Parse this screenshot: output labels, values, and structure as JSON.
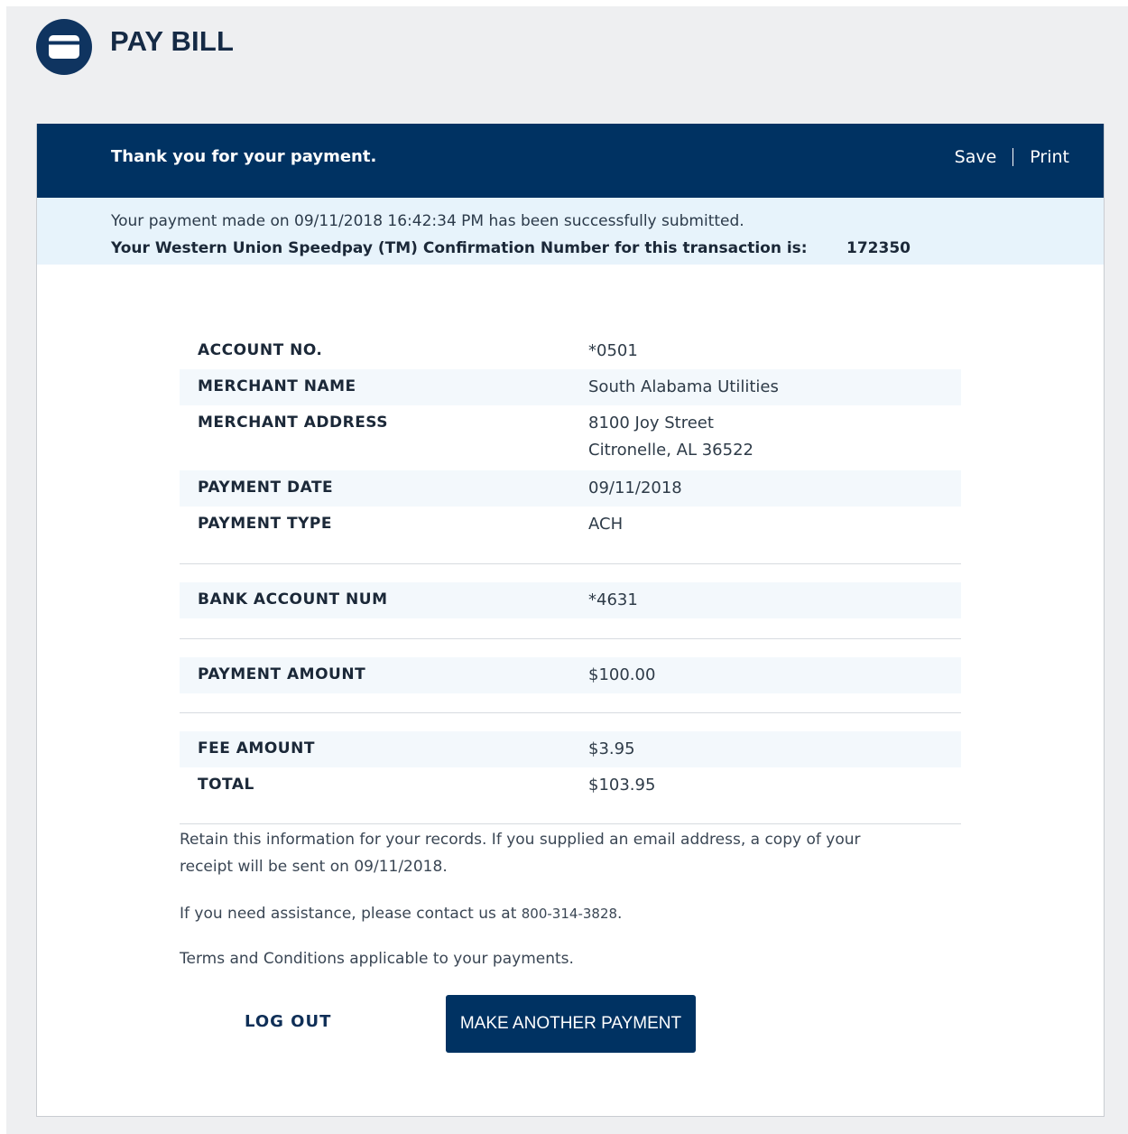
{
  "header": {
    "icon": "credit-card-icon",
    "title": "PAY BILL"
  },
  "banner": {
    "message": "Thank you for your payment.",
    "save_label": "Save",
    "print_label": "Print"
  },
  "notice": {
    "submitted_text": "Your payment made on 09/11/2018 16:42:34 PM has been successfully submitted.",
    "confirmation_label": "Your Western Union Speedpay (TM) Confirmation Number for this transaction is:",
    "confirmation_number": "172350"
  },
  "details": {
    "account_no": {
      "label": "ACCOUNT NO.",
      "value": "*0501"
    },
    "merchant_name": {
      "label": "MERCHANT NAME",
      "value": "South Alabama Utilities"
    },
    "merchant_address": {
      "label": "MERCHANT ADDRESS",
      "line1": "8100 Joy Street",
      "line2": "Citronelle, AL 36522"
    },
    "payment_date": {
      "label": "PAYMENT DATE",
      "value": "09/11/2018"
    },
    "payment_type": {
      "label": "PAYMENT TYPE",
      "value": "ACH"
    },
    "bank_account": {
      "label": "BANK ACCOUNT NUM",
      "value": "*4631"
    },
    "payment_amount": {
      "label": "PAYMENT AMOUNT",
      "value": "$100.00"
    },
    "fee_amount": {
      "label": "FEE AMOUNT",
      "value": "$3.95"
    },
    "total": {
      "label": "TOTAL",
      "value": "$103.95"
    }
  },
  "footer": {
    "retain_line1": "Retain this information for your records. If you supplied an email address, a copy of your",
    "retain_line2": "receipt will be sent on 09/11/2018.",
    "assist_prefix": "If you need assistance, please contact us at ",
    "assist_phone": "800-314-3828",
    "assist_suffix": ".",
    "terms_link": "Terms and Conditions",
    "terms_suffix": " applicable to your payments."
  },
  "actions": {
    "logout_label": "LOG OUT",
    "make_payment_label": "MAKE ANOTHER PAYMENT"
  },
  "colors": {
    "primary_navy": "#003262",
    "notice_bg": "#e7f3fb",
    "row_shade": "#f3f8fc"
  }
}
